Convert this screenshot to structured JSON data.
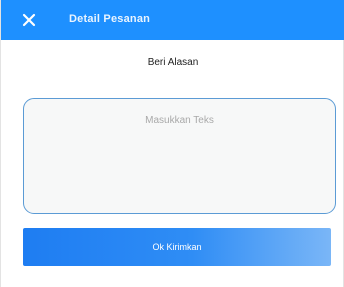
{
  "header": {
    "title": "Detail Pesanan",
    "close_icon": "close-icon"
  },
  "form": {
    "subtitle": "Beri Alasan",
    "textarea_placeholder": "Masukkan Teks",
    "textarea_value": "",
    "submit_label": "Ok Kirimkan"
  },
  "colors": {
    "header_bg": "#1e90ff",
    "accent": "#1e7df2",
    "textarea_border": "#5b9bd5"
  }
}
